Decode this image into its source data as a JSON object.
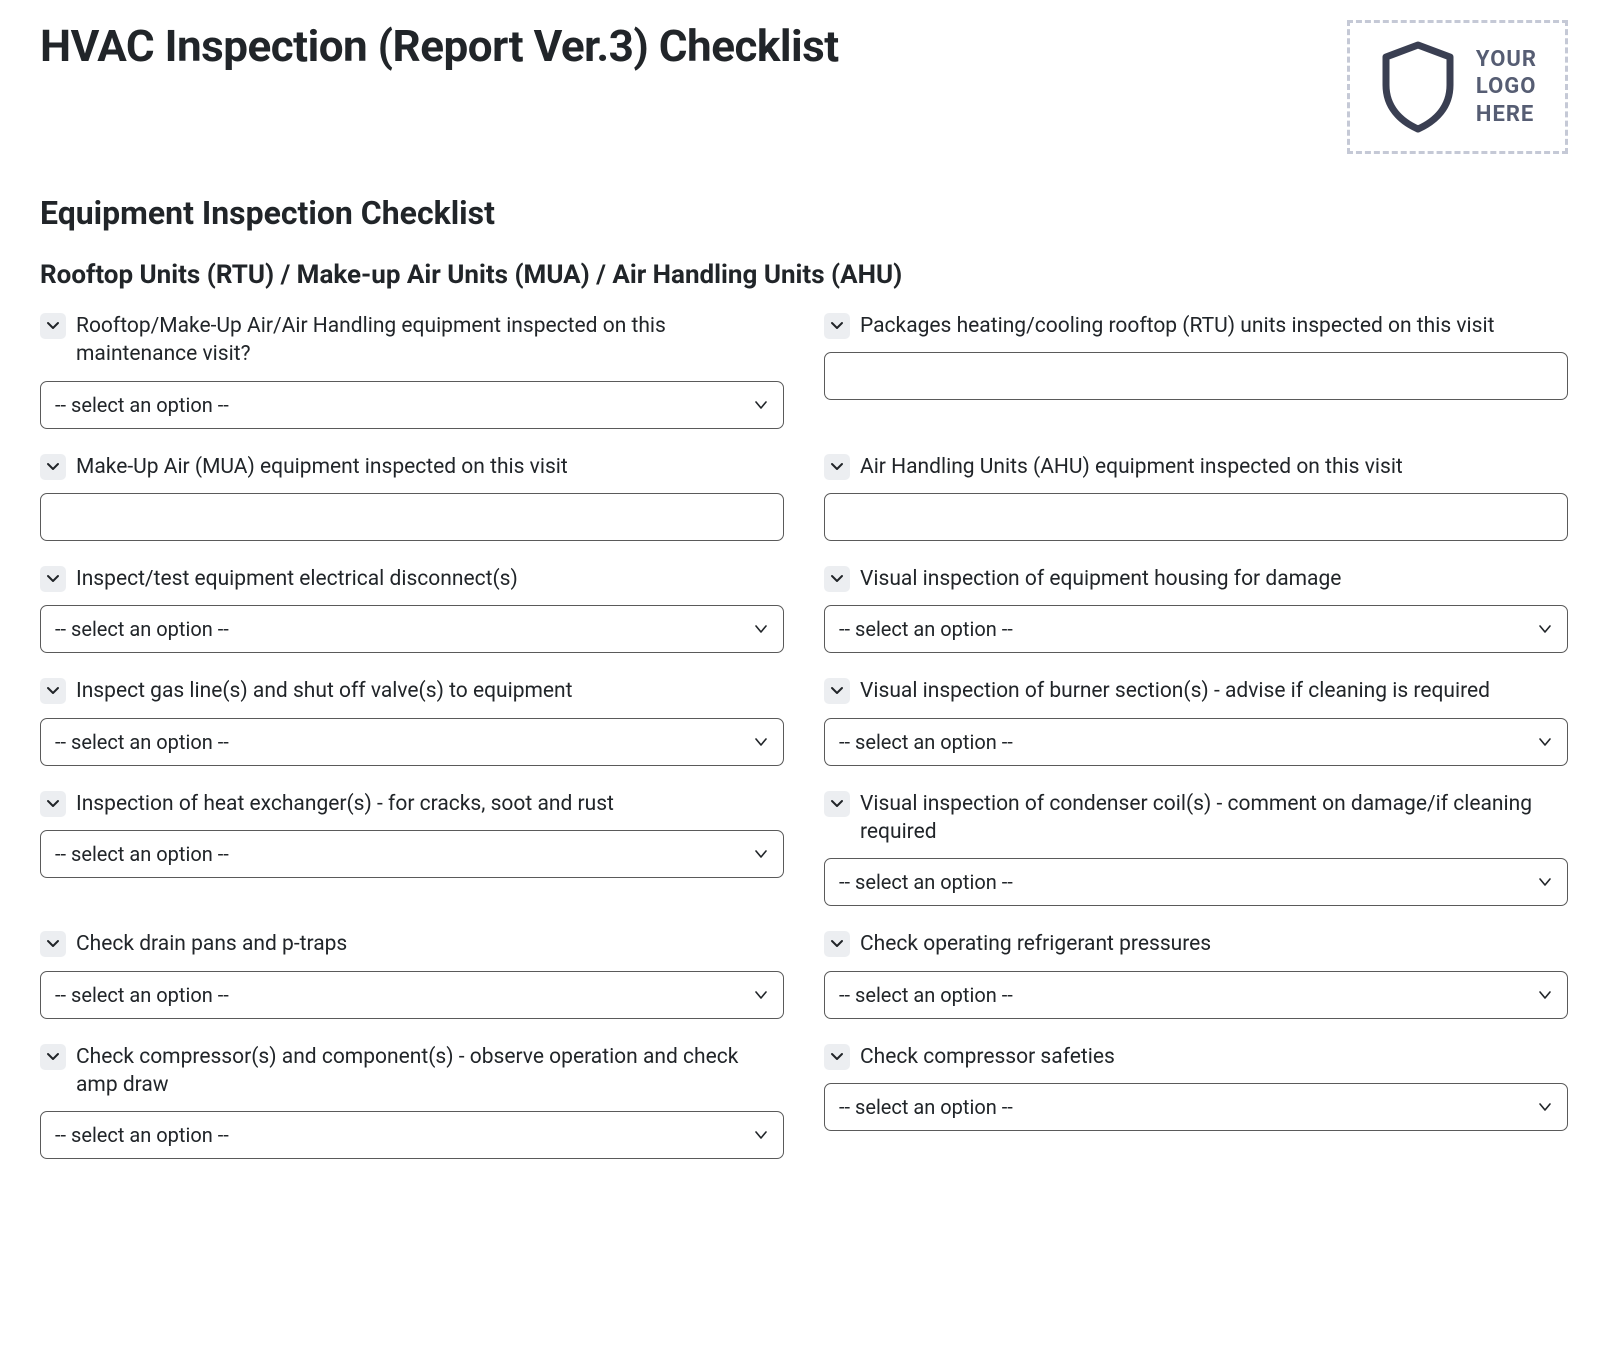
{
  "title": "HVAC Inspection (Report Ver.3) Checklist",
  "logo_text": "YOUR\nLOGO\nHERE",
  "section_title": "Equipment Inspection Checklist",
  "subsection_title": "Rooftop Units (RTU) / Make-up Air Units (MUA) / Air Handling Units (AHU)",
  "placeholder": "-- select an option --",
  "fields": {
    "f0": {
      "label": "Rooftop/Make-Up Air/Air Handling equipment inspected on this maintenance visit?",
      "type": "select"
    },
    "f1": {
      "label": "Packages heating/cooling rooftop (RTU) units inspected on this visit",
      "type": "text"
    },
    "f2": {
      "label": "Make-Up Air (MUA) equipment inspected on this visit",
      "type": "text"
    },
    "f3": {
      "label": "Air Handling Units (AHU) equipment inspected on this visit",
      "type": "text"
    },
    "f4": {
      "label": "Inspect/test equipment electrical disconnect(s)",
      "type": "select"
    },
    "f5": {
      "label": "Visual inspection of equipment housing for damage",
      "type": "select"
    },
    "f6": {
      "label": "Inspect gas line(s) and shut off valve(s) to equipment",
      "type": "select"
    },
    "f7": {
      "label": "Visual inspection of burner section(s) - advise if cleaning is required",
      "type": "select"
    },
    "f8": {
      "label": "Inspection of heat exchanger(s) - for cracks, soot and rust",
      "type": "select"
    },
    "f9": {
      "label": "Visual inspection of condenser coil(s) - comment on damage/if cleaning required",
      "type": "select"
    },
    "f10": {
      "label": "Check drain pans and p-traps",
      "type": "select"
    },
    "f11": {
      "label": "Check operating refrigerant pressures",
      "type": "select"
    },
    "f12": {
      "label": "Check compressor(s) and component(s) - observe operation and check amp draw",
      "type": "select"
    },
    "f13": {
      "label": "Check compressor safeties",
      "type": "select"
    }
  }
}
